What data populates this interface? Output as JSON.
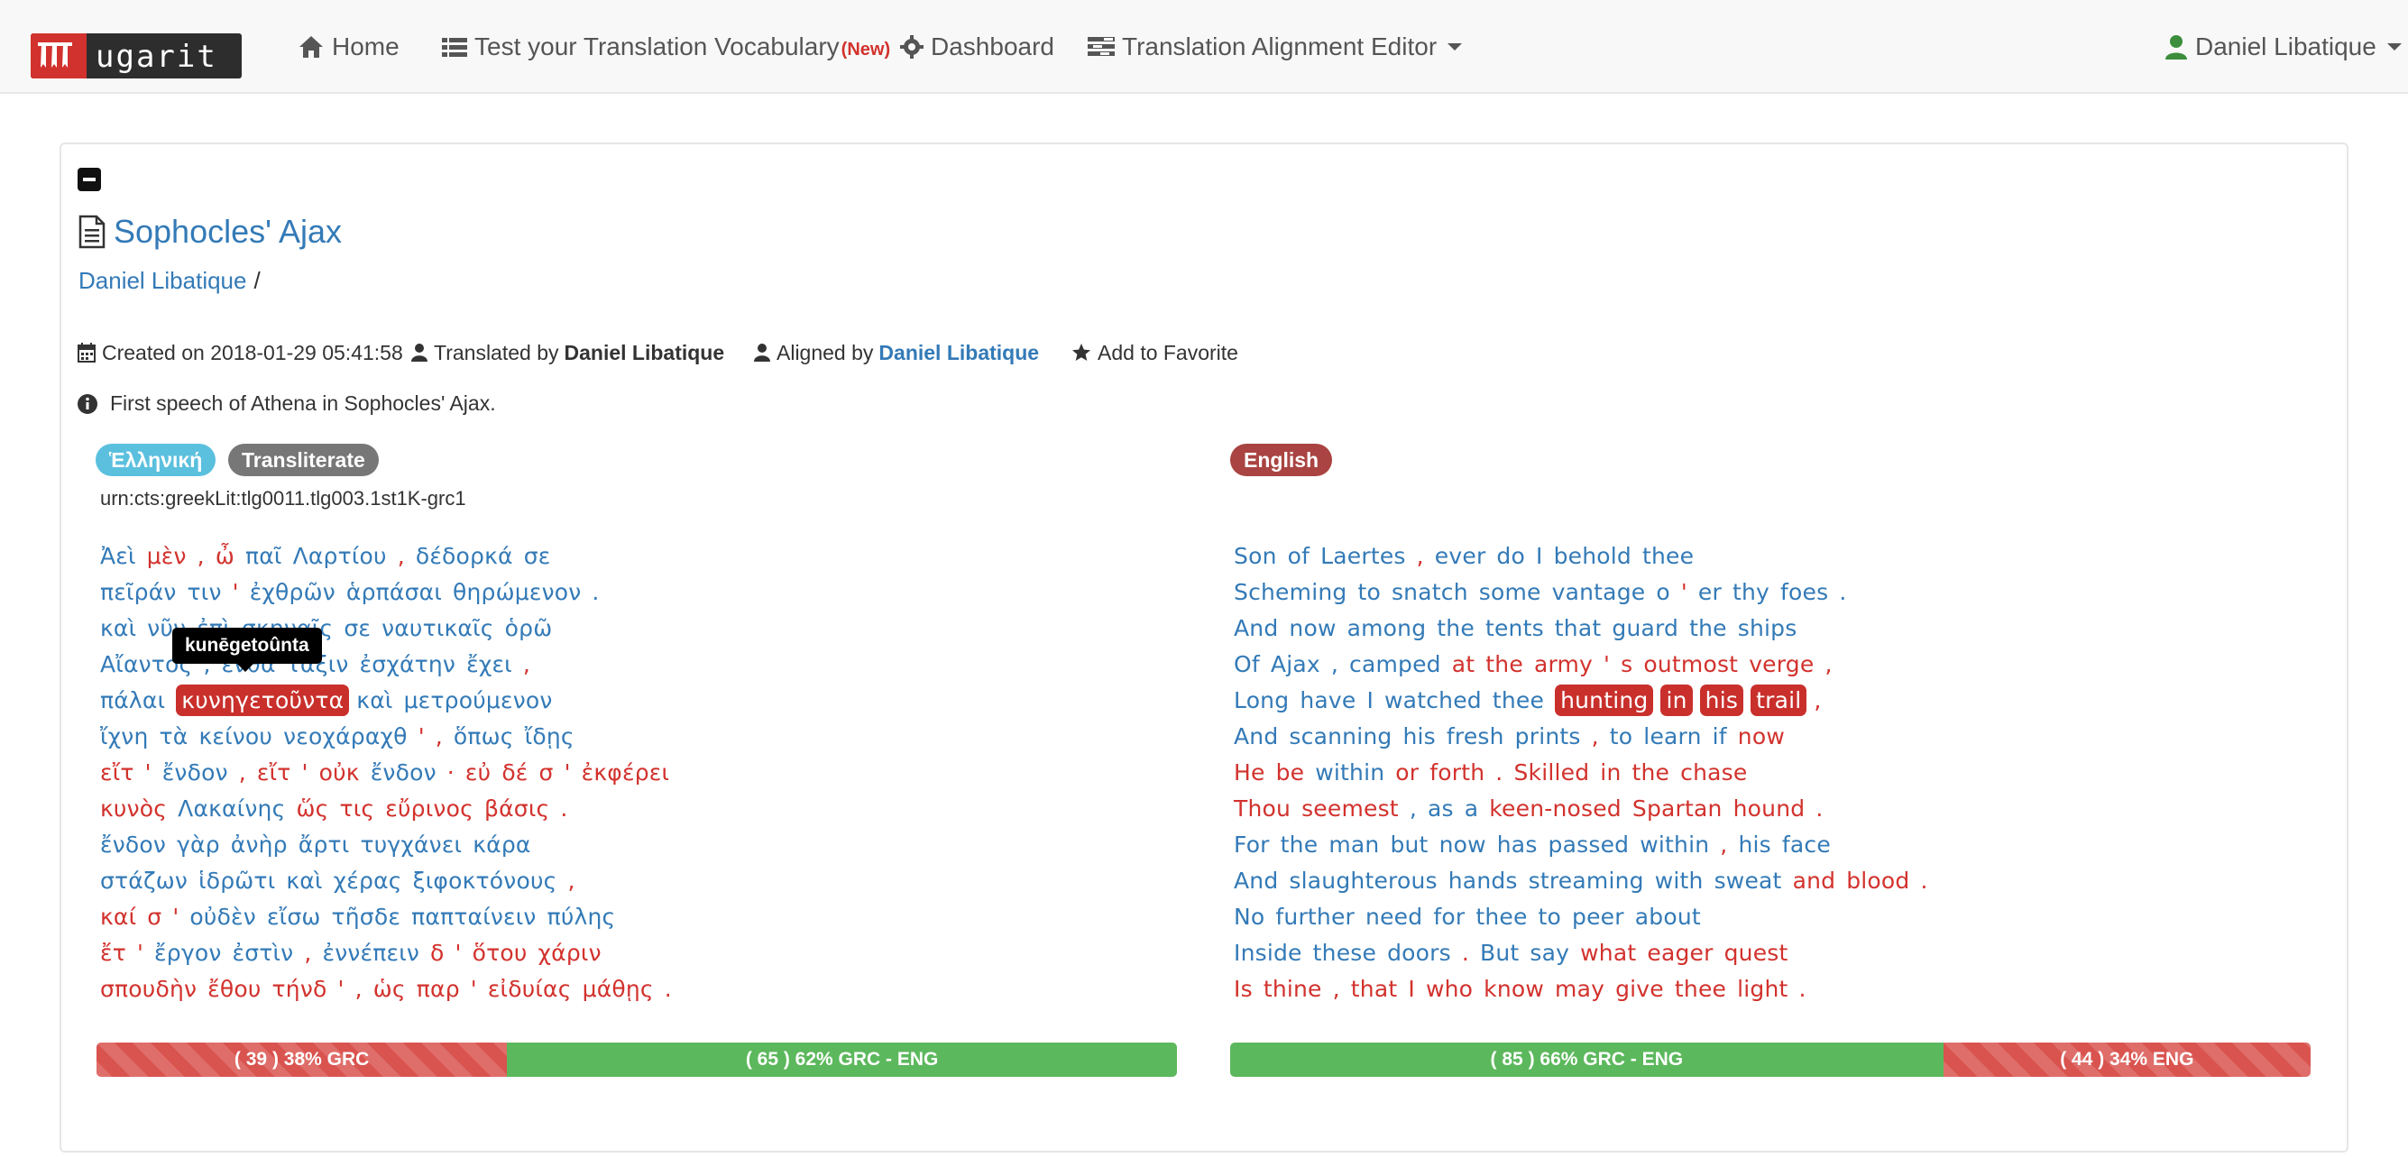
{
  "navbar": {
    "brand": "ugarit",
    "home": "Home",
    "vocab": "Test your Translation Vocabulary",
    "vocab_badge": "(New)",
    "dashboard": "Dashboard",
    "alignment_editor": "Translation Alignment Editor",
    "user": "Daniel Libatique"
  },
  "doc": {
    "title": "Sophocles' Ajax",
    "owner": "Daniel Libatique",
    "owner_sep": "/",
    "created": "Created on 2018-01-29 05:41:58",
    "translated_label": "Translated by",
    "translated_by": "Daniel Libatique",
    "aligned_label": "Aligned by",
    "aligned_by": "Daniel Libatique",
    "favorite": "Add to Favorite",
    "description": "First speech of Athena in Sophocles' Ajax."
  },
  "left": {
    "lang_label": "Ἑλληνική",
    "translit_label": "Transliterate",
    "urn": "urn:cts:greekLit:tlg0011.tlg003.1st1K-grc1",
    "tooltip": "kunēgetoûnta",
    "lines": [
      [
        [
          "Ἀεὶ",
          "a"
        ],
        [
          "μὲν",
          "u"
        ],
        [
          ",",
          "u"
        ],
        [
          "ὦ",
          "u"
        ],
        [
          "παῖ",
          "a"
        ],
        [
          "Λαρτίου",
          "a"
        ],
        [
          ",",
          "u"
        ],
        [
          "δέδορκά",
          "a"
        ],
        [
          "σε",
          "a"
        ]
      ],
      [
        [
          "πεῖράν",
          "a"
        ],
        [
          "τιν",
          "a"
        ],
        [
          "'",
          "u"
        ],
        [
          "ἐχθρῶν",
          "a"
        ],
        [
          "ἁρπάσαι",
          "a"
        ],
        [
          "θηρώμενον",
          "a"
        ],
        [
          ".",
          "a"
        ]
      ],
      [
        [
          "καὶ",
          "a"
        ],
        [
          "νῦν",
          "a"
        ],
        [
          "ἐπὶ",
          "a"
        ],
        [
          "σκηναῖς",
          "a"
        ],
        [
          "σε",
          "a"
        ],
        [
          "ναυτικαῖς",
          "a"
        ],
        [
          "ὁρῶ",
          "a"
        ]
      ],
      [
        [
          "Αἴαντος",
          "a"
        ],
        [
          ",",
          "a"
        ],
        [
          "ἔνθα",
          "a"
        ],
        [
          "τάξιν",
          "a"
        ],
        [
          "ἐσχάτην",
          "a"
        ],
        [
          "ἔχει",
          "a"
        ],
        [
          ",",
          "u"
        ]
      ],
      [
        [
          "πάλαι",
          "a"
        ],
        [
          "κυνηγετοῦντα",
          "h"
        ],
        [
          "καὶ",
          "a"
        ],
        [
          "μετρούμενον",
          "a"
        ]
      ],
      [
        [
          "ἴχνη",
          "a"
        ],
        [
          "τὰ",
          "a"
        ],
        [
          "κείνου",
          "a"
        ],
        [
          "νεοχάραχθ",
          "a"
        ],
        [
          "'",
          "u"
        ],
        [
          ",",
          "u"
        ],
        [
          "ὅπως",
          "a"
        ],
        [
          "ἴδῃς",
          "a"
        ]
      ],
      [
        [
          "εἴτ",
          "u"
        ],
        [
          "'",
          "u"
        ],
        [
          "ἔνδον",
          "a"
        ],
        [
          ",",
          "u"
        ],
        [
          "εἴτ",
          "u"
        ],
        [
          "'",
          "u"
        ],
        [
          "οὐκ",
          "u"
        ],
        [
          "ἔνδον",
          "a"
        ],
        [
          "·",
          "u"
        ],
        [
          "εὐ",
          "u"
        ],
        [
          "δέ",
          "u"
        ],
        [
          "σ",
          "u"
        ],
        [
          "'",
          "u"
        ],
        [
          "ἐκφέρει",
          "u"
        ]
      ],
      [
        [
          "κυνὸς",
          "u"
        ],
        [
          "Λακαίνης",
          "a"
        ],
        [
          "ὥς",
          "u"
        ],
        [
          "τις",
          "u"
        ],
        [
          "εὔρινος",
          "u"
        ],
        [
          "βάσις",
          "u"
        ],
        [
          ".",
          "u"
        ]
      ],
      [
        [
          "ἔνδον",
          "a"
        ],
        [
          "γὰρ",
          "a"
        ],
        [
          "ἀνὴρ",
          "a"
        ],
        [
          "ἄρτι",
          "a"
        ],
        [
          "τυγχάνει",
          "a"
        ],
        [
          "κάρα",
          "a"
        ]
      ],
      [
        [
          "στάζων",
          "a"
        ],
        [
          "ἱδρῶτι",
          "a"
        ],
        [
          "καὶ",
          "a"
        ],
        [
          "χέρας",
          "a"
        ],
        [
          "ξιφοκτόνους",
          "a"
        ],
        [
          ",",
          "u"
        ]
      ],
      [
        [
          "καί",
          "u"
        ],
        [
          "σ",
          "u"
        ],
        [
          "'",
          "u"
        ],
        [
          "οὐδὲν",
          "a"
        ],
        [
          "εἴσω",
          "a"
        ],
        [
          "τῆσδε",
          "a"
        ],
        [
          "παπταίνειν",
          "a"
        ],
        [
          "πύλης",
          "a"
        ]
      ],
      [
        [
          "ἔτ",
          "u"
        ],
        [
          "'",
          "u"
        ],
        [
          "ἔργον",
          "a"
        ],
        [
          "ἐστὶν",
          "a"
        ],
        [
          ",",
          "u"
        ],
        [
          "ἐννέπειν",
          "a"
        ],
        [
          "δ",
          "u"
        ],
        [
          "'",
          "u"
        ],
        [
          "ὅτου",
          "u"
        ],
        [
          "χάριν",
          "u"
        ]
      ],
      [
        [
          "σπουδὴν",
          "u"
        ],
        [
          "ἔθου",
          "u"
        ],
        [
          "τήνδ",
          "u"
        ],
        [
          "'",
          "u"
        ],
        [
          ",",
          "u"
        ],
        [
          "ὡς",
          "u"
        ],
        [
          "παρ",
          "u"
        ],
        [
          "'",
          "u"
        ],
        [
          "εἰδυίας",
          "u"
        ],
        [
          "μάθῃς",
          "u"
        ],
        [
          ".",
          "u"
        ]
      ]
    ],
    "progress": {
      "unaligned": "( 39 ) 38% GRC",
      "unaligned_pct": 38,
      "aligned": "( 65 ) 62% GRC - ENG",
      "aligned_pct": 62
    }
  },
  "right": {
    "lang_label": "English",
    "lines": [
      [
        [
          "Son",
          "a"
        ],
        [
          "of",
          "a"
        ],
        [
          "Laertes",
          "a"
        ],
        [
          ",",
          "u"
        ],
        [
          "ever",
          "a"
        ],
        [
          "do",
          "a"
        ],
        [
          "I",
          "a"
        ],
        [
          "behold",
          "a"
        ],
        [
          "thee",
          "a"
        ]
      ],
      [
        [
          "Scheming",
          "a"
        ],
        [
          "to",
          "a"
        ],
        [
          "snatch",
          "a"
        ],
        [
          "some",
          "a"
        ],
        [
          "vantage",
          "a"
        ],
        [
          "o",
          "a"
        ],
        [
          "'",
          "u"
        ],
        [
          "er",
          "a"
        ],
        [
          "thy",
          "a"
        ],
        [
          "foes",
          "a"
        ],
        [
          ".",
          "a"
        ]
      ],
      [
        [
          "And",
          "a"
        ],
        [
          "now",
          "a"
        ],
        [
          "among",
          "a"
        ],
        [
          "the",
          "a"
        ],
        [
          "tents",
          "a"
        ],
        [
          "that",
          "a"
        ],
        [
          "guard",
          "a"
        ],
        [
          "the",
          "a"
        ],
        [
          "ships",
          "a"
        ]
      ],
      [
        [
          "Of",
          "a"
        ],
        [
          "Ajax",
          "a"
        ],
        [
          ",",
          "a"
        ],
        [
          "camped",
          "a"
        ],
        [
          "at",
          "u"
        ],
        [
          "the",
          "u"
        ],
        [
          "army",
          "u"
        ],
        [
          "'",
          "u"
        ],
        [
          "s",
          "u"
        ],
        [
          "outmost",
          "u"
        ],
        [
          "verge",
          "u"
        ],
        [
          ",",
          "u"
        ]
      ],
      [
        [
          "Long",
          "a"
        ],
        [
          "have",
          "a"
        ],
        [
          "I",
          "a"
        ],
        [
          "watched",
          "a"
        ],
        [
          "thee",
          "a"
        ],
        [
          "hunting",
          "h"
        ],
        [
          "in",
          "h"
        ],
        [
          "his",
          "h"
        ],
        [
          "trail",
          "h"
        ],
        [
          ",",
          "u"
        ]
      ],
      [
        [
          "And",
          "a"
        ],
        [
          "scanning",
          "a"
        ],
        [
          "his",
          "a"
        ],
        [
          "fresh",
          "a"
        ],
        [
          "prints",
          "a"
        ],
        [
          ",",
          "u"
        ],
        [
          "to",
          "a"
        ],
        [
          "learn",
          "a"
        ],
        [
          "if",
          "a"
        ],
        [
          "now",
          "u"
        ]
      ],
      [
        [
          "He",
          "u"
        ],
        [
          "be",
          "u"
        ],
        [
          "within",
          "a"
        ],
        [
          "or",
          "u"
        ],
        [
          "forth",
          "u"
        ],
        [
          ".",
          "u"
        ],
        [
          "Skilled",
          "u"
        ],
        [
          "in",
          "u"
        ],
        [
          "the",
          "u"
        ],
        [
          "chase",
          "u"
        ]
      ],
      [
        [
          "Thou",
          "u"
        ],
        [
          "seemest",
          "u"
        ],
        [
          ",",
          "a"
        ],
        [
          "as",
          "a"
        ],
        [
          "a",
          "a"
        ],
        [
          "keen-nosed",
          "u"
        ],
        [
          "Spartan",
          "u"
        ],
        [
          "hound",
          "u"
        ],
        [
          ".",
          "u"
        ]
      ],
      [
        [
          "For",
          "a"
        ],
        [
          "the",
          "a"
        ],
        [
          "man",
          "a"
        ],
        [
          "but",
          "a"
        ],
        [
          "now",
          "a"
        ],
        [
          "has",
          "a"
        ],
        [
          "passed",
          "a"
        ],
        [
          "within",
          "a"
        ],
        [
          ",",
          "u"
        ],
        [
          "his",
          "a"
        ],
        [
          "face",
          "a"
        ]
      ],
      [
        [
          "And",
          "a"
        ],
        [
          "slaughterous",
          "a"
        ],
        [
          "hands",
          "a"
        ],
        [
          "streaming",
          "a"
        ],
        [
          "with",
          "a"
        ],
        [
          "sweat",
          "a"
        ],
        [
          "and",
          "u"
        ],
        [
          "blood",
          "u"
        ],
        [
          ".",
          "u"
        ]
      ],
      [
        [
          "No",
          "a"
        ],
        [
          "further",
          "a"
        ],
        [
          "need",
          "a"
        ],
        [
          "for",
          "a"
        ],
        [
          "thee",
          "a"
        ],
        [
          "to",
          "a"
        ],
        [
          "peer",
          "a"
        ],
        [
          "about",
          "a"
        ]
      ],
      [
        [
          "Inside",
          "a"
        ],
        [
          "these",
          "a"
        ],
        [
          "doors",
          "a"
        ],
        [
          ".",
          "u"
        ],
        [
          "But",
          "a"
        ],
        [
          "say",
          "a"
        ],
        [
          "what",
          "u"
        ],
        [
          "eager",
          "u"
        ],
        [
          "quest",
          "u"
        ]
      ],
      [
        [
          "Is",
          "u"
        ],
        [
          "thine",
          "u"
        ],
        [
          ",",
          "u"
        ],
        [
          "that",
          "u"
        ],
        [
          "I",
          "u"
        ],
        [
          "who",
          "u"
        ],
        [
          "know",
          "u"
        ],
        [
          "may",
          "u"
        ],
        [
          "give",
          "u"
        ],
        [
          "thee",
          "u"
        ],
        [
          "light",
          "u"
        ],
        [
          ".",
          "u"
        ]
      ]
    ],
    "progress": {
      "aligned": "( 85 ) 66% GRC - ENG",
      "aligned_pct": 66,
      "unaligned": "( 44 ) 34% ENG",
      "unaligned_pct": 34
    }
  },
  "colors": {
    "aligned": "#337ab7",
    "unaligned": "#d2322d",
    "highlight": "#c9302c",
    "green": "#5cb85c",
    "label_lang": "#5bc0de",
    "label_translit": "#777777",
    "label_english": "#a94442"
  }
}
